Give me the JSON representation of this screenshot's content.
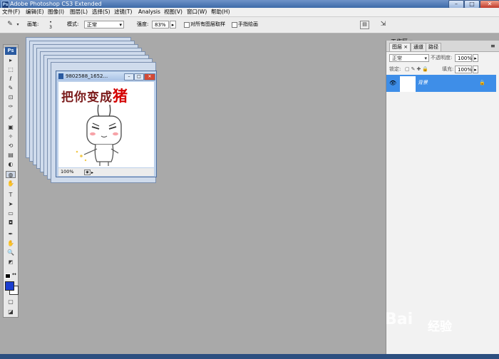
{
  "window": {
    "title": "Adobe Photoshop CS3 Extended",
    "app_badge": "Ps",
    "min": "–",
    "max": "□",
    "close": "✕"
  },
  "menu": [
    "文件(F)",
    "编辑(E)",
    "图像(I)",
    "图层(L)",
    "选择(S)",
    "滤镜(T)",
    "Analysis",
    "视图(V)",
    "窗口(W)",
    "帮助(H)"
  ],
  "options": {
    "brush_label": "画笔:",
    "brush_size": "3",
    "mode_label": "模式:",
    "mode_value": "正常",
    "strength_label": "强度:",
    "strength_value": "83%",
    "sample_all_label": "对所有图层取样",
    "finger_label": "手指绘画"
  },
  "workspace_label": "工作区 ▾",
  "toolbox": {
    "badge": "Ps",
    "tools": [
      "▸",
      "⬚",
      "ℓ",
      "✎",
      "⊡",
      "✑",
      "✐",
      "▣",
      "✧",
      "⟲",
      "▤",
      "◐",
      "◍",
      "✋",
      "T",
      "➤",
      "▭",
      "◘",
      "✒",
      "✋",
      "🔍",
      "◩",
      "▢",
      "◪"
    ]
  },
  "document": {
    "name": "9802588_1652...",
    "zoom": "100%",
    "headline": "把你变成",
    "headline_red": "猪"
  },
  "panel": {
    "tabs": [
      "图层 ×",
      "通道",
      "路径"
    ],
    "blend_mode": "正常",
    "opacity_label": "不透明度:",
    "opacity_value": "100%",
    "lock_label": "锁定:",
    "fill_label": "填充:",
    "fill_value": "100%",
    "layer_name": "背景"
  },
  "watermark": {
    "brand": "Bai",
    "brand_cn": "经验"
  },
  "colors": {
    "foreground": "#1a3ed0",
    "background": "#ffffff",
    "selection": "#3e8ee8",
    "red": "#d40000"
  }
}
